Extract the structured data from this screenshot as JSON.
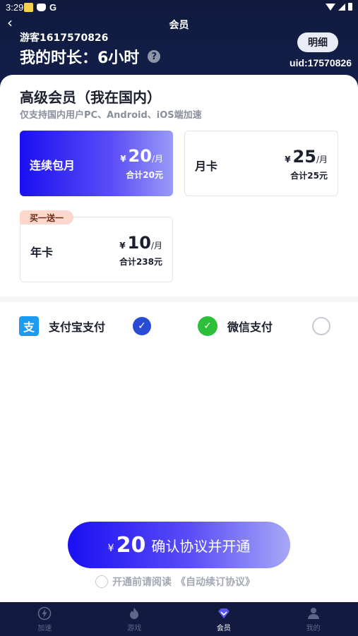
{
  "status_bar": {
    "time": "3:29",
    "g_letter": "G"
  },
  "nav": {
    "back_glyph": "‹",
    "title": "会员"
  },
  "user": {
    "username": "游客1617570826",
    "duration_label": "我的时长：6小时",
    "help_glyph": "?",
    "detail_button": "明细",
    "uid": "uid:17570826"
  },
  "plan_section": {
    "title": "高级会员（我在国内）",
    "subtitle": "仅支持国内用户PC、Android、iOS端加速"
  },
  "plans": [
    {
      "name": "连续包月",
      "currency": "¥",
      "price": "20",
      "per": "/月",
      "total": "合计20元",
      "selected": true
    },
    {
      "name": "月卡",
      "currency": "¥",
      "price": "25",
      "per": "/月",
      "total": "合计25元",
      "selected": false
    },
    {
      "name": "年卡",
      "currency": "¥",
      "price": "10",
      "per": "/月",
      "total": "合计238元",
      "selected": false,
      "badge": "买一送一"
    }
  ],
  "payment": {
    "alipay": {
      "label": "支付宝支付",
      "icon": "alipay-icon",
      "icon_glyph": "支",
      "checked": true
    },
    "wechat": {
      "label": "微信支付",
      "icon": "wechat-icon",
      "icon_glyph": "✓",
      "checked": false
    }
  },
  "cta": {
    "currency": "¥",
    "amount": "20",
    "label": "确认协议并开通"
  },
  "agreement": {
    "prefix": "开通前请阅读",
    "link": "《自动续订协议》"
  },
  "tabs": [
    {
      "label": "加速",
      "icon": "lightning-icon",
      "active": false
    },
    {
      "label": "游戏",
      "icon": "flame-icon",
      "active": false
    },
    {
      "label": "会员",
      "icon": "diamond-icon",
      "active": true
    },
    {
      "label": "我的",
      "icon": "person-icon",
      "active": false
    }
  ],
  "colors": {
    "header_bg": "#13204b",
    "accent_blue": "#1a10f2",
    "radio_checked": "#2a4bd6",
    "promo_badge": "#fcd7cd"
  }
}
